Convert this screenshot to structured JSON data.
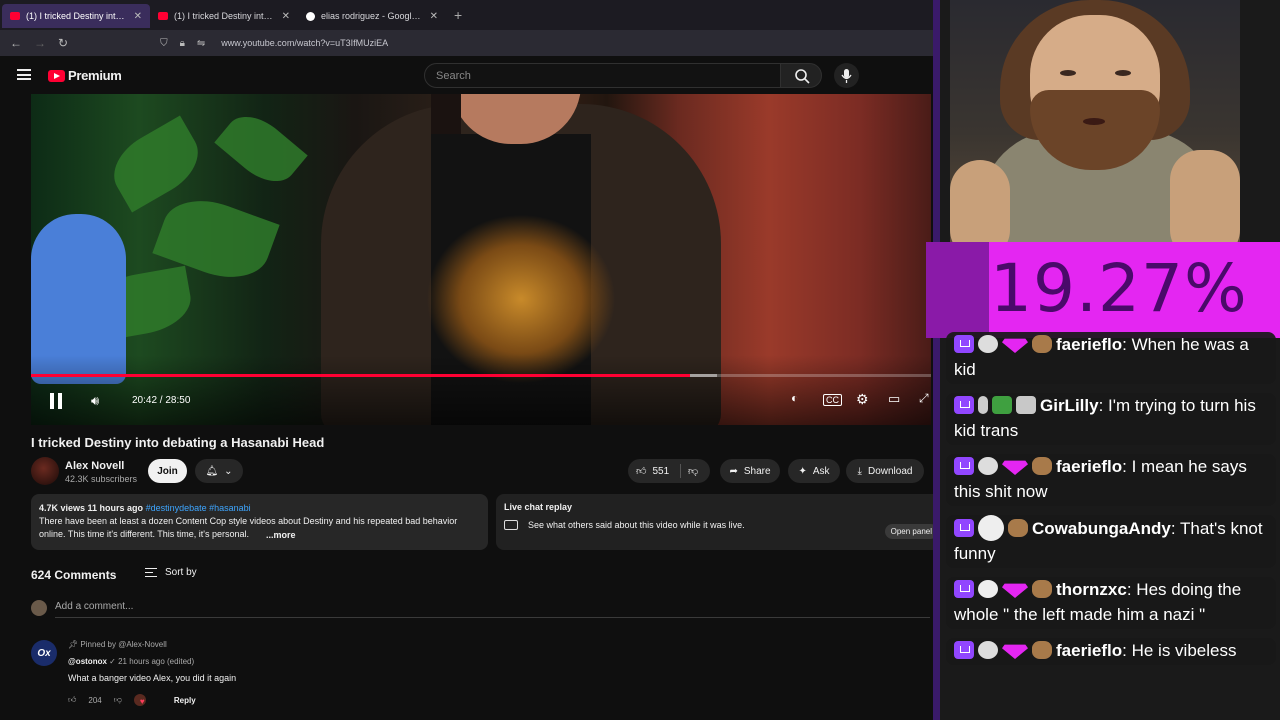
{
  "browser": {
    "tabs": [
      {
        "label": "(1) I tricked Destiny into de",
        "active": true,
        "favicon_color": "#ff0033"
      },
      {
        "label": "(1) I tricked Destiny into de",
        "active": false,
        "favicon_color": "#ff0033"
      },
      {
        "label": "elias rodriguez - Google Search",
        "active": false,
        "favicon_color": "#ffffff"
      }
    ],
    "url": "www.youtube.com/watch?v=uT3IfMUziEA"
  },
  "youtube": {
    "logo_text": "Premium",
    "search_placeholder": "Search"
  },
  "player": {
    "time_display": "20:42 / 28:50",
    "progress_played": 0.732,
    "progress_buffered": 0.762
  },
  "video": {
    "title": "I tricked Destiny into debating a Hasanabi Head",
    "channel": "Alex Novell",
    "subscribers": "42.3K subscribers",
    "join_label": "Join",
    "likes": "551",
    "share_label": "Share",
    "ask_label": "Ask",
    "download_label": "Download",
    "views_and_time": "4.7K views  11 hours ago",
    "hashtags": "#destinydebate #hasanabi",
    "description": "There have been at least a dozen Content Cop style videos about Destiny and his repeated bad behavior online. This time it's different. This time, it's personal.",
    "more_label": "...more"
  },
  "live_chat_replay": {
    "title": "Live chat replay",
    "text": "See what others said about this video while it was live.",
    "button": "Open panel"
  },
  "comments": {
    "count_label": "624 Comments",
    "sort_label": "Sort by",
    "add_placeholder": "Add a comment...",
    "pinned": {
      "pinned_by": "Pinned by @Alex-Novell",
      "author": "@ostonox",
      "meta": "21 hours ago (edited)",
      "text": "What a banger video Alex, you did it again",
      "likes": "204",
      "reply_label": "Reply",
      "avatar_text": "Ox"
    }
  },
  "stream": {
    "percent": "19.27%",
    "accent": "#e426f2",
    "chat": [
      {
        "user": "faerieflo",
        "message": "When he was a kid",
        "badges": [
          "twitch",
          "skull",
          "gem",
          "dog"
        ],
        "color": "#ffffff"
      },
      {
        "user": "GirLilly",
        "message": "I'm trying to turn his kid trans",
        "badges": [
          "twitch",
          "key",
          "frog",
          "clap"
        ],
        "color": "#ffffff"
      },
      {
        "user": "faerieflo",
        "message": "I mean he says this shit now",
        "badges": [
          "twitch",
          "skull",
          "gem",
          "dog"
        ],
        "color": "#ffffff"
      },
      {
        "user": "CowabungaAndy",
        "message": "That's knot funny",
        "badges": [
          "twitch",
          "sub",
          "dog"
        ],
        "color": "#ffffff"
      },
      {
        "user": "thornzxc",
        "message": "Hes doing the whole \" the left made him a nazi \"",
        "badges": [
          "twitch",
          "pup",
          "gem",
          "dog"
        ],
        "color": "#ffffff"
      },
      {
        "user": "faerieflo",
        "message": "He is vibeless",
        "badges": [
          "twitch",
          "skull",
          "gem",
          "dog"
        ],
        "color": "#ffffff"
      }
    ]
  }
}
